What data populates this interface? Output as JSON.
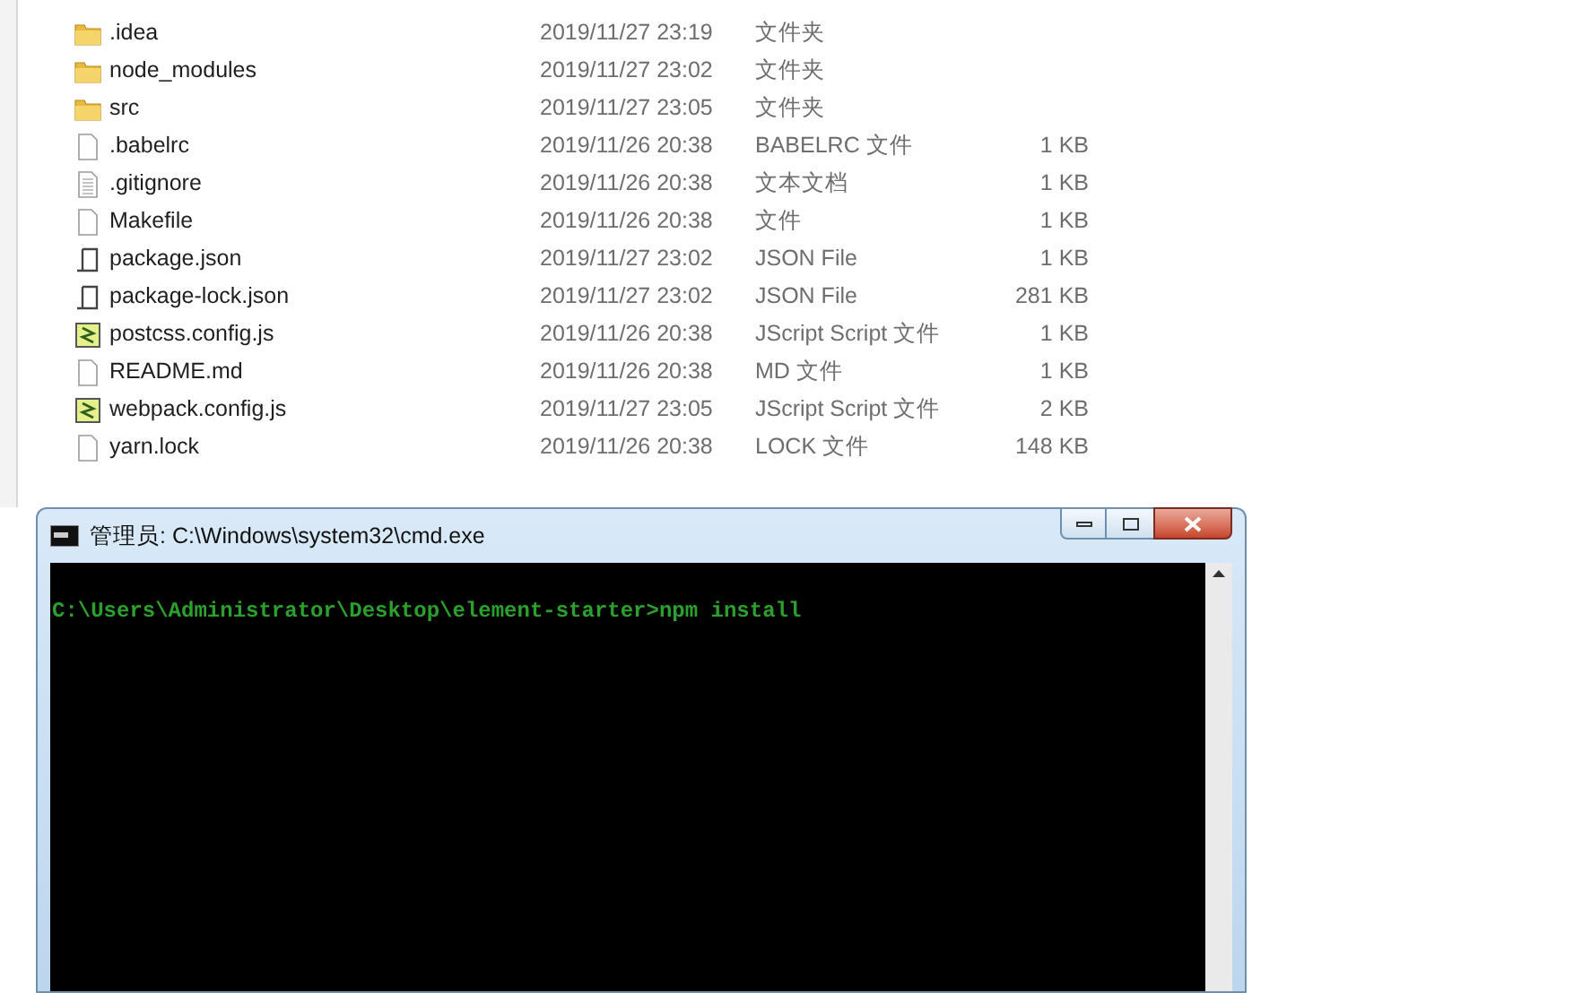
{
  "files": [
    {
      "name": ".idea",
      "date": "2019/11/27 23:19",
      "type": "文件夹",
      "kind": "folder"
    },
    {
      "name": "node_modules",
      "date": "2019/11/27 23:02",
      "type": "文件夹",
      "kind": "folder"
    },
    {
      "name": "src",
      "date": "2019/11/27 23:05",
      "type": "文件夹",
      "kind": "folder"
    },
    {
      "name": ".babelrc",
      "date": "2019/11/26 20:38",
      "type": "BABELRC 文件",
      "size": "1 KB",
      "kind": "file"
    },
    {
      "name": ".gitignore",
      "date": "2019/11/26 20:38",
      "type": "文本文档",
      "size": "1 KB",
      "kind": "text"
    },
    {
      "name": "Makefile",
      "date": "2019/11/26 20:38",
      "type": "文件",
      "size": "1 KB",
      "kind": "file"
    },
    {
      "name": "package.json",
      "date": "2019/11/27 23:02",
      "type": "JSON File",
      "size": "1 KB",
      "kind": "json"
    },
    {
      "name": "package-lock.json",
      "date": "2019/11/27 23:02",
      "type": "JSON File",
      "size": "281 KB",
      "kind": "json"
    },
    {
      "name": "postcss.config.js",
      "date": "2019/11/26 20:38",
      "type": "JScript Script 文件",
      "size": "1 KB",
      "kind": "script"
    },
    {
      "name": "README.md",
      "date": "2019/11/26 20:38",
      "type": "MD 文件",
      "size": "1 KB",
      "kind": "file"
    },
    {
      "name": "webpack.config.js",
      "date": "2019/11/27 23:05",
      "type": "JScript Script 文件",
      "size": "2 KB",
      "kind": "script"
    },
    {
      "name": "yarn.lock",
      "date": "2019/11/26 20:38",
      "type": "LOCK 文件",
      "size": "148 KB",
      "kind": "file"
    }
  ],
  "console": {
    "title": "管理员: C:\\Windows\\system32\\cmd.exe",
    "lines": [
      "C:\\Users\\Administrator\\Desktop\\element-starter>npm install"
    ]
  }
}
